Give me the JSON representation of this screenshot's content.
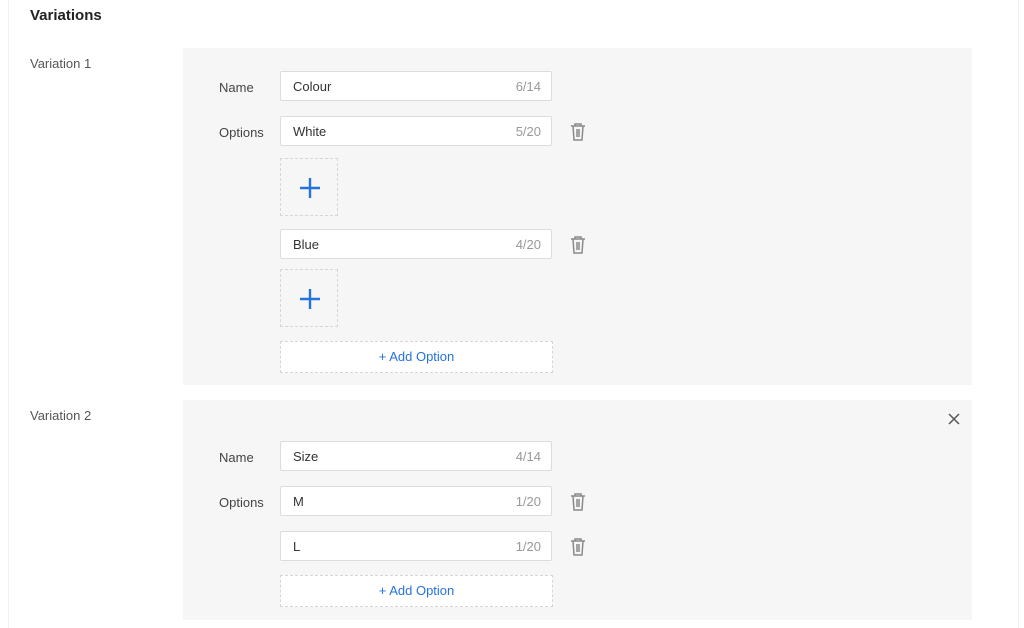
{
  "section_title": "Variations",
  "variation1": {
    "label": "Variation 1",
    "name_label": "Name",
    "name_value": "Colour",
    "name_count": "6/14",
    "options_label": "Options",
    "options": [
      {
        "value": "White",
        "count": "5/20"
      },
      {
        "value": "Blue",
        "count": "4/20"
      }
    ],
    "add_option_label": "+ Add Option"
  },
  "variation2": {
    "label": "Variation 2",
    "name_label": "Name",
    "name_value": "Size",
    "name_count": "4/14",
    "options_label": "Options",
    "options": [
      {
        "value": "M",
        "count": "1/20"
      },
      {
        "value": "L",
        "count": "1/20"
      }
    ],
    "add_option_label": "+ Add Option"
  },
  "colors": {
    "accent": "#2673dd",
    "box_bg": "#f6f6f6",
    "border": "#dcdcdc",
    "icon": "#8a8a8a"
  }
}
